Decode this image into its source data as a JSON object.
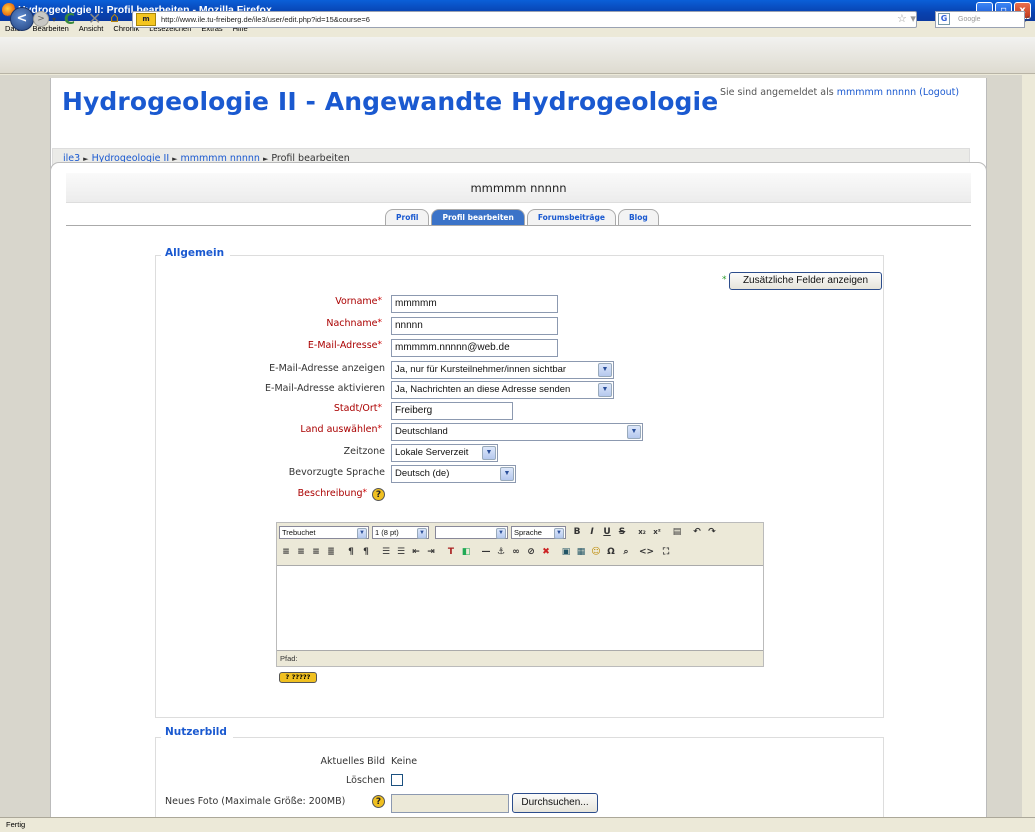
{
  "window": {
    "title": "Hydrogeologie II: Profil bearbeiten - Mozilla Firefox",
    "controls": [
      "_",
      "▫",
      "x"
    ]
  },
  "menu": [
    "Datei",
    "Bearbeiten",
    "Ansicht",
    "Chronik",
    "Lesezeichen",
    "Extras",
    "Hilfe"
  ],
  "nav": {
    "url": "http://www.ile.tu-freiberg.de/ile3/user/edit.php?id=15&course=6",
    "site_badge": "m",
    "search_placeholder": "Google"
  },
  "page": {
    "heading": "Hydrogeologie II - Angewandte Hydrogeologie",
    "login_prefix": "Sie sind angemeldet als",
    "login_user": "mmmmm nnnnn",
    "logout_label": "(Logout)",
    "breadcrumb": [
      "ile3",
      "Hydrogeologie II",
      "mmmmm nnnnn",
      "Profil bearbeiten"
    ],
    "breadcrumb_sep": "►",
    "user_heading": "mmmmm nnnnn",
    "tabs": [
      "Profil",
      "Profil bearbeiten",
      "Forumsbeiträge",
      "Blog"
    ]
  },
  "allgemein": {
    "legend": "Allgemein",
    "more_fields_button": "Zusätzliche Felder anzeigen",
    "required_marker": "*",
    "fields": {
      "vorname": {
        "label": "Vorname",
        "value": "mmmmm"
      },
      "nachname": {
        "label": "Nachname",
        "value": "nnnnn"
      },
      "email": {
        "label": "E-Mail-Adresse",
        "value": "mmmmm.nnnnn@web.de"
      },
      "email_show": {
        "label": "E-Mail-Adresse anzeigen",
        "value": "Ja, nur für Kursteilnehmer/innen sichtbar"
      },
      "email_active": {
        "label": "E-Mail-Adresse aktivieren",
        "value": "Ja, Nachrichten an diese Adresse senden"
      },
      "stadt": {
        "label": "Stadt/Ort",
        "value": "Freiberg"
      },
      "land": {
        "label": "Land auswählen",
        "value": "Deutschland"
      },
      "zeitzone": {
        "label": "Zeitzone",
        "value": "Lokale Serverzeit"
      },
      "sprache": {
        "label": "Bevorzugte Sprache",
        "value": "Deutsch (de)"
      },
      "beschreibung": {
        "label": "Beschreibung"
      }
    }
  },
  "editor": {
    "font": "Trebuchet",
    "size": "1 (8 pt)",
    "format": "",
    "language": "Sprache",
    "path_label": "Pfad:",
    "help_tag": "? ?????"
  },
  "nutzerbild": {
    "legend": "Nutzerbild",
    "current_label": "Aktuelles Bild",
    "current_value": "Keine",
    "delete_label": "Löschen",
    "new_photo_label": "Neues Foto (Maximale Größe: 200MB)",
    "browse_button": "Durchsuchen..."
  },
  "status": "Fertig"
}
